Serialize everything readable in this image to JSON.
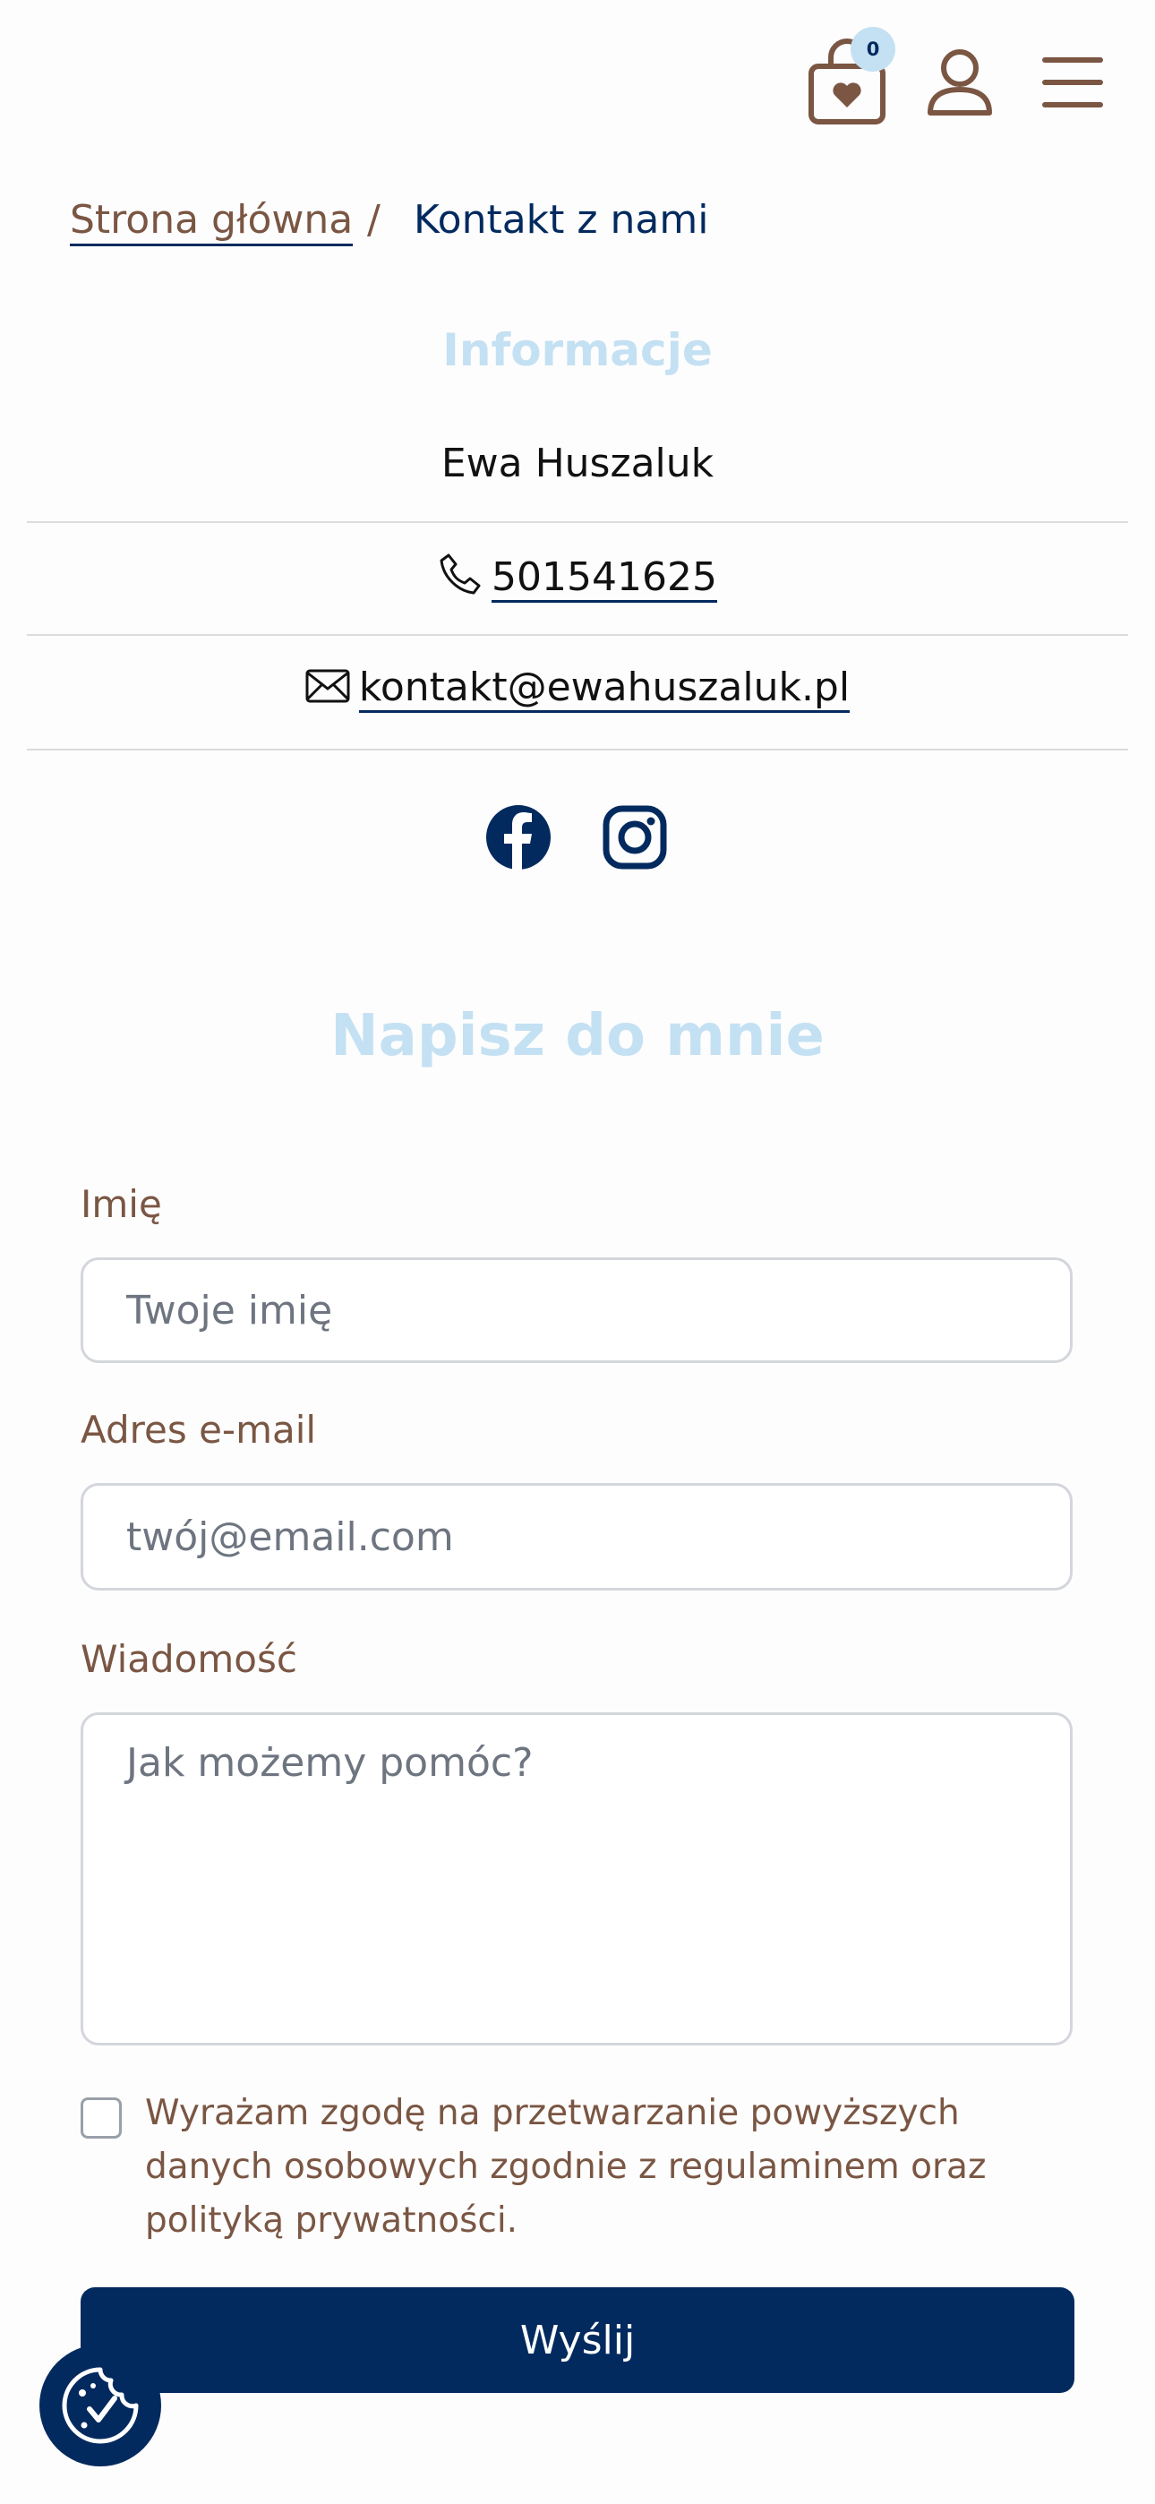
{
  "header": {
    "cart_count": "0",
    "icons": [
      "shopping-bag-heart-icon",
      "user-icon",
      "hamburger-menu-icon"
    ],
    "brand_color": "#7a5643"
  },
  "breadcrumb": {
    "home": "Strona główna",
    "separator": "/",
    "current": "Kontakt z nami"
  },
  "info": {
    "title": "Informacje",
    "name": "Ewa Huszaluk",
    "phone": "501541625",
    "email": "kontakt@ewahuszaluk.pl",
    "social": [
      "facebook-icon",
      "instagram-icon"
    ]
  },
  "form": {
    "title": "Napisz do mnie",
    "name_label": "Imię",
    "name_placeholder": "Twoje imię",
    "email_label": "Adres e-mail",
    "email_placeholder": "twój@email.com",
    "message_label": "Wiadomość",
    "message_placeholder": "Jak możemy pomóc?",
    "consent": "Wyrażam zgodę na przetwarzanie powyższych danych osobowych zgodnie z regulaminem oraz polityką prywatności.",
    "submit": "Wyślij"
  },
  "colors": {
    "accent_navy": "#032a5e",
    "title_light_blue": "#c4e1f3",
    "label_brown": "#7a5643"
  },
  "cookie": {
    "icon": "cookie-consent-icon"
  }
}
